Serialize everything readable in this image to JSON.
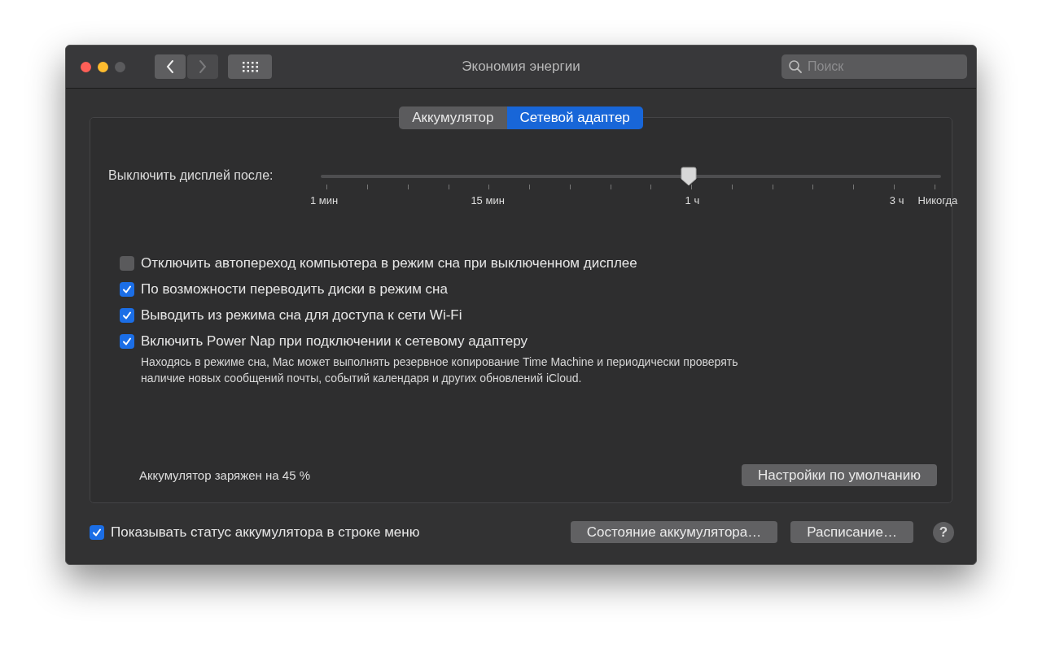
{
  "window": {
    "title": "Экономия энергии",
    "forward_disabled": true
  },
  "search": {
    "placeholder": "Поиск"
  },
  "tabs": [
    {
      "label": "Аккумулятор",
      "selected": false
    },
    {
      "label": "Сетевой адаптер",
      "selected": true
    }
  ],
  "display_sleep": {
    "label": "Выключить дисплей после:",
    "level": 0.595,
    "tick_labels": [
      "1 мин",
      "15 мин",
      "1 ч",
      "3 ч",
      "Никогда"
    ]
  },
  "options": [
    {
      "label": "Отключить автопереход компьютера в режим сна при выключенном дисплее",
      "checked": false
    },
    {
      "label": "По возможности переводить диски в режим сна",
      "checked": true
    },
    {
      "label": "Выводить из режима сна для доступа к сети Wi-Fi",
      "checked": true
    },
    {
      "label": "Включить Power Nap при подключении к сетевому адаптеру",
      "checked": true,
      "description": "Находясь в режиме сна, Mac может выполнять резервное копирование Time Machine и периодически проверять наличие новых сообщений почты, событий календаря и других обновлений iCloud."
    }
  ],
  "battery_status": "Аккумулятор заряжен на 45 %",
  "defaults_button": "Настройки по умолчанию",
  "show_status": {
    "label": "Показывать статус аккумулятора в строке меню",
    "checked": true
  },
  "buttons": [
    "Состояние аккумулятора…",
    "Расписание…"
  ],
  "help": "?"
}
